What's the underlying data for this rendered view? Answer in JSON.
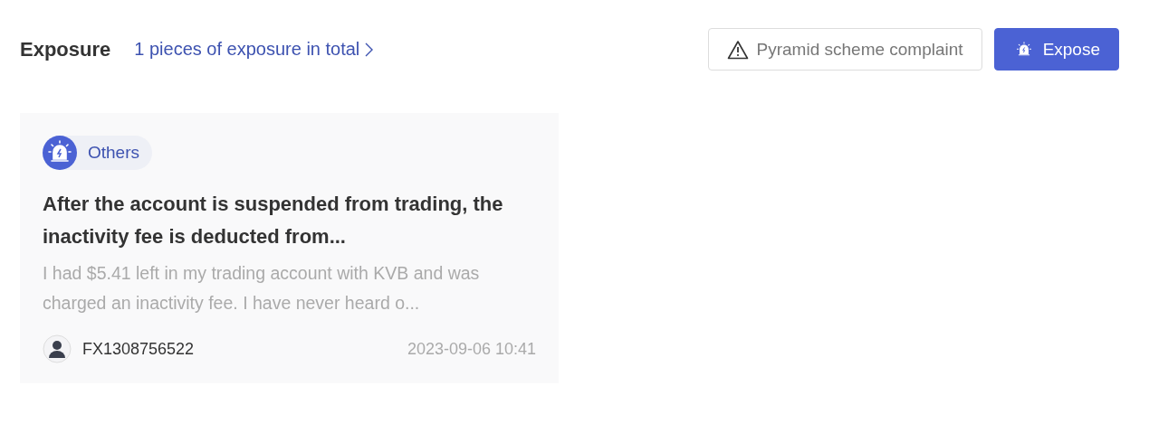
{
  "header": {
    "title": "Exposure",
    "summary_link": "1 pieces of exposure in total"
  },
  "actions": [
    {
      "kind": "outline",
      "label": "Pyramid scheme complaint"
    },
    {
      "kind": "primary",
      "label": "Expose"
    }
  ],
  "cards": [
    {
      "category": "Others",
      "title": "After the account is suspended from trading, the inactivity fee is deducted from...",
      "excerpt": "I had $5.41 left in my trading account with KVB and was charged an inactivity fee. I have never heard o...",
      "user": "FX1308756522",
      "time": "2023-09-06 10:41"
    }
  ]
}
